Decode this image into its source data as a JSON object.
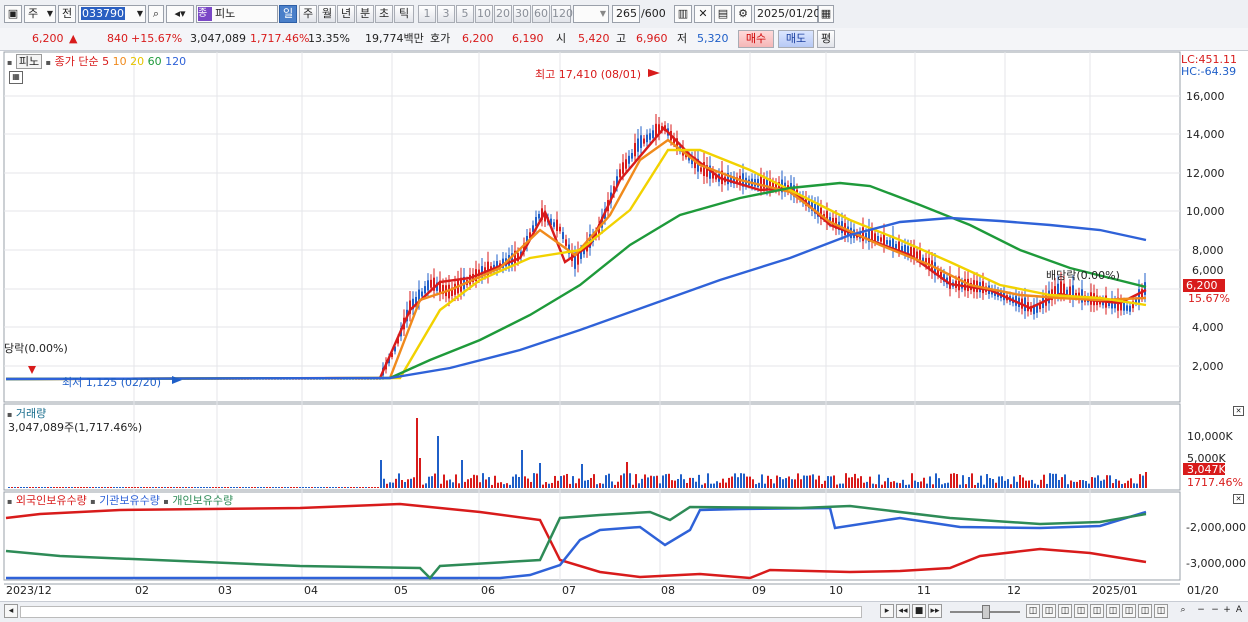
{
  "toolbar": {
    "type_label": "주",
    "prev_label": "전",
    "code_value": "033790",
    "name_badge": "종",
    "name_value": "피노",
    "periods": [
      "일",
      "주",
      "월",
      "년",
      "분",
      "초",
      "틱"
    ],
    "active_period": "일",
    "intervals": [
      "1",
      "3",
      "5",
      "10",
      "20",
      "30",
      "60",
      "120"
    ],
    "count_value": "265",
    "count_total": "/600",
    "date_value": "2025/01/20"
  },
  "quote": {
    "price": "6,200",
    "change": "840",
    "change_pct": "+15.67%",
    "volume": "3,047,089",
    "vol_ratio": "1,717.46%",
    "turnover": "13.35%",
    "amount": "19,774백만",
    "bid_label": "호가",
    "bid1": "6,200",
    "bid2": "6,190",
    "open_label": "시",
    "open": "5,420",
    "high_label": "고",
    "high": "6,960",
    "low_label": "저",
    "low": "5,320",
    "buy_label": "매수",
    "sell_label": "매도",
    "eval_label": "평"
  },
  "price_chart": {
    "stock_label": "피노",
    "ma_title": "종가 단순",
    "ma_periods": [
      "5",
      "10",
      "20",
      "60",
      "120"
    ],
    "ma_colors": [
      "#d81b1b",
      "#f08a1c",
      "#f2d200",
      "#1e9a3a",
      "#2f62d8"
    ],
    "lc_label": "LC:451.11",
    "hc_label": "HC:-64.39",
    "max_annotation": "최고 17,410 (08/01)",
    "min_annotation": "최저 1,125 (02/20)",
    "div_left": "당락(0.00%)",
    "div_right": "배당락(0.00%)",
    "price_tag": "6,200",
    "pct_tag": "15.67%",
    "y_ticks": [
      "16,000",
      "14,000",
      "12,000",
      "10,000",
      "8,000",
      "6,000",
      "4,000",
      "2,000"
    ]
  },
  "volume_chart": {
    "title": "거래량",
    "value_text": "3,047,089주(1,717.46%)",
    "y_ticks": [
      "10,000K",
      "5,000K"
    ],
    "tag": "3,047K",
    "tag_pct": "1717.46%"
  },
  "holder_chart": {
    "legend": [
      "외국인보유수량",
      "기관보유수량",
      "개인보유수량"
    ],
    "colors": [
      "#d81b1b",
      "#2f62d8",
      "#2e8b57"
    ],
    "y_ticks": [
      "-2,000,000",
      "-3,000,000"
    ]
  },
  "x_axis": [
    "2023/12",
    "02",
    "03",
    "04",
    "05",
    "06",
    "07",
    "08",
    "09",
    "10",
    "11",
    "12",
    "2025/01",
    "01/20"
  ]
}
